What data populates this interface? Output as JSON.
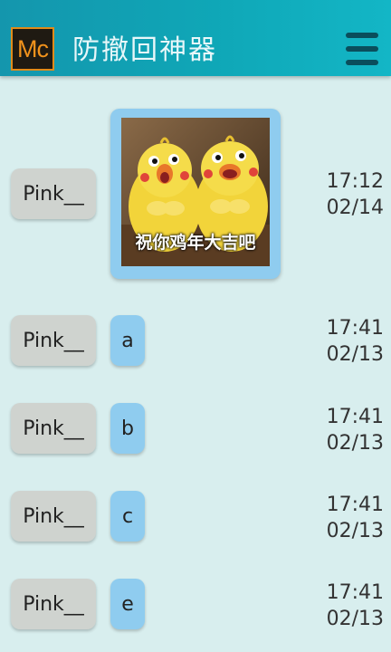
{
  "header": {
    "logo_text": "Mc",
    "title": "防撤回神器"
  },
  "messages": [
    {
      "sender": "Pink__",
      "type": "image",
      "caption": "祝你鸡年大吉吧",
      "time": "17:12",
      "date": "02/14"
    },
    {
      "sender": "Pink__",
      "type": "text",
      "text": "a",
      "time": "17:41",
      "date": "02/13"
    },
    {
      "sender": "Pink__",
      "type": "text",
      "text": "b",
      "time": "17:41",
      "date": "02/13"
    },
    {
      "sender": "Pink__",
      "type": "text",
      "text": "c",
      "time": "17:41",
      "date": "02/13"
    },
    {
      "sender": "Pink__",
      "type": "text",
      "text": "e",
      "time": "17:41",
      "date": "02/13"
    }
  ],
  "colors": {
    "header": "#0fa7b7",
    "background": "#d8eeee",
    "bubble": "#8fccef",
    "sender_chip": "#cfd3cf",
    "logo_accent": "#f0921c"
  },
  "icons": {
    "logo": "mc-logo-icon",
    "menu": "hamburger-menu-icon"
  }
}
